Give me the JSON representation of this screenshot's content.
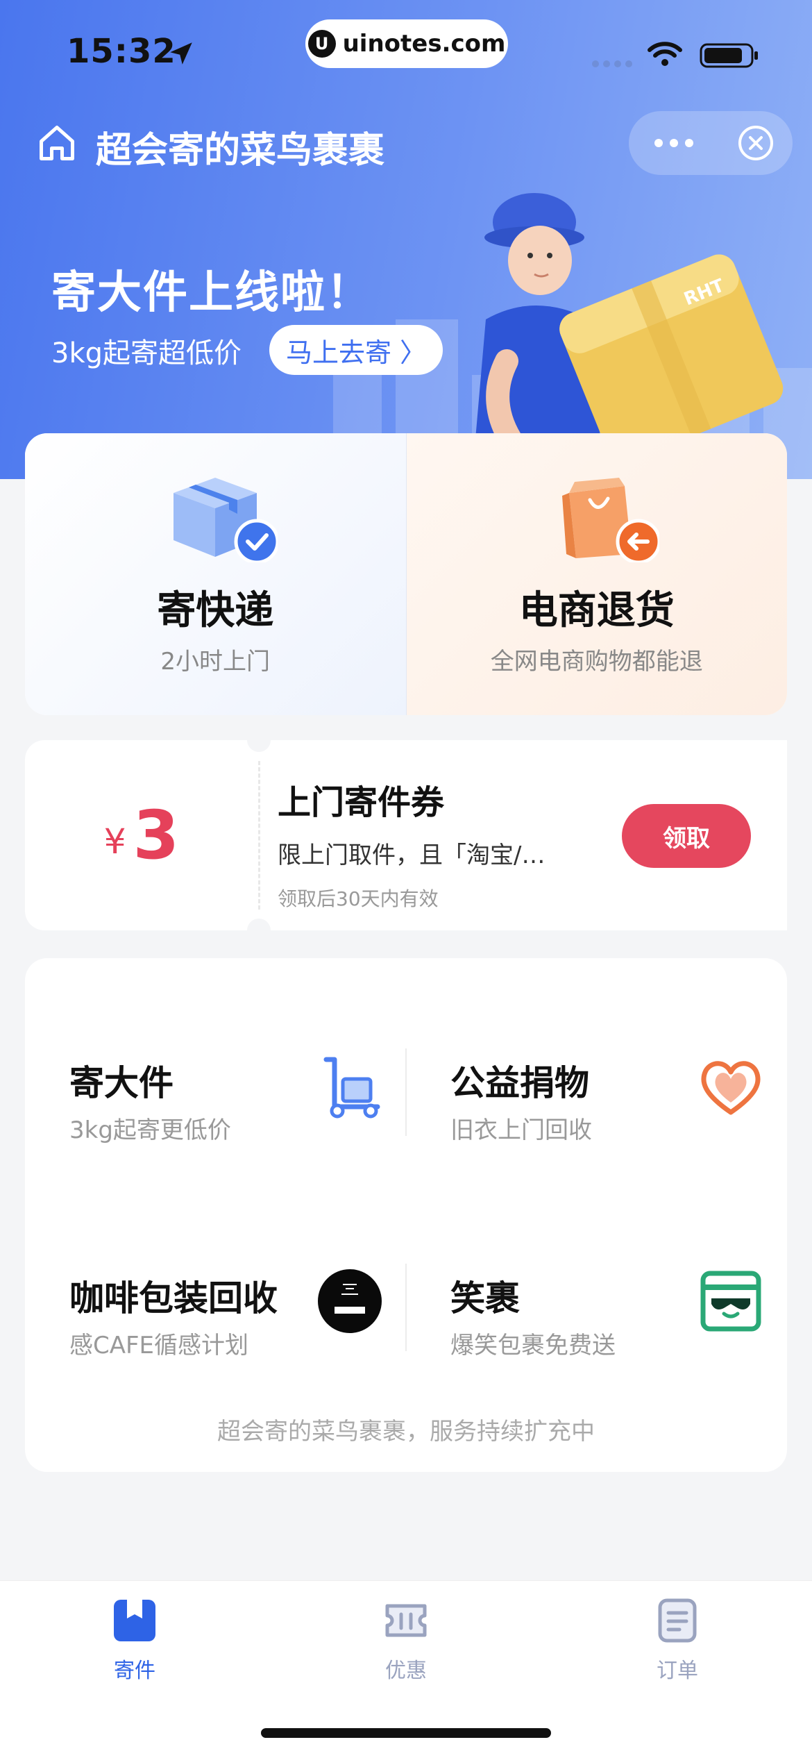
{
  "status_bar": {
    "time": "15:32",
    "url": "uinotes.com",
    "url_logo": "U"
  },
  "nav": {
    "title": "超会寄的菜鸟裹裹"
  },
  "banner": {
    "title": "寄大件上线啦！",
    "subtitle": "3kg起寄超低价",
    "cta": "马上去寄 〉",
    "box_label": "RHT"
  },
  "services": [
    {
      "title": "寄快递",
      "subtitle": "2小时上门",
      "icon": "package-check-icon"
    },
    {
      "title": "电商退货",
      "subtitle": "全网电商购物都能退",
      "icon": "shopping-bag-return-icon"
    }
  ],
  "coupon": {
    "currency": "¥",
    "amount": "3",
    "title": "上门寄件券",
    "description": "限上门取件，且「淘宝/…",
    "validity": "领取后30天内有效",
    "button": "领取"
  },
  "grid": {
    "items": [
      {
        "title": "寄大件",
        "subtitle": "3kg起寄更低价",
        "icon": "hand-truck-icon"
      },
      {
        "title": "公益捐物",
        "subtitle": "旧衣上门回收",
        "icon": "heart-icon"
      },
      {
        "title": "咖啡包装回收",
        "subtitle": "感CAFE循感计划",
        "icon": "nescafe-logo-icon"
      },
      {
        "title": "笑裹",
        "subtitle": "爆笑包裹免费送",
        "icon": "sunglasses-box-icon"
      }
    ],
    "footer": "超会寄的菜鸟裹裹，服务持续扩充中"
  },
  "tabbar": [
    {
      "label": "寄件",
      "icon": "send-icon",
      "active": true
    },
    {
      "label": "优惠",
      "icon": "coupon-icon",
      "active": false
    },
    {
      "label": "订单",
      "icon": "order-list-icon",
      "active": false
    }
  ],
  "colors": {
    "primary": "#2e63e6",
    "accent_red": "#e5475e",
    "banner_blue": "#4a76ee"
  }
}
